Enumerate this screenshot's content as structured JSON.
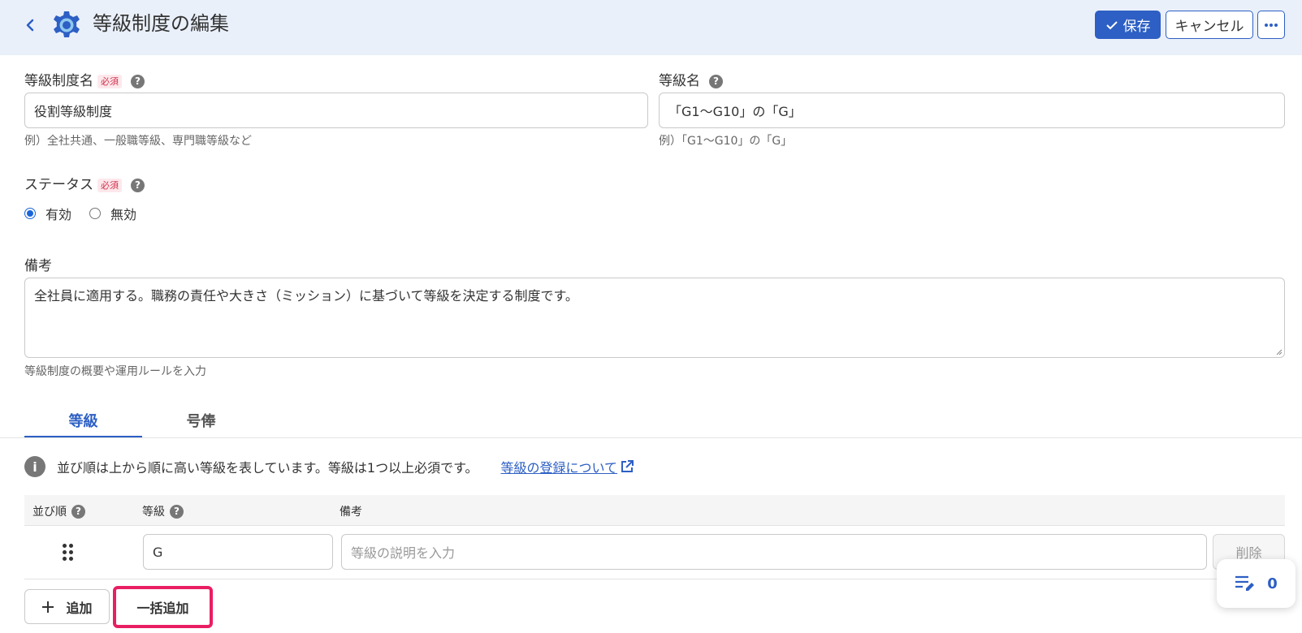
{
  "header": {
    "title": "等級制度の編集",
    "save_label": "保存",
    "cancel_label": "キャンセル"
  },
  "form": {
    "system_name": {
      "label": "等級制度名",
      "required": "必須",
      "value": "役割等級制度",
      "hint": "例）全社共通、一般職等級、専門職等級など"
    },
    "grade_name": {
      "label": "等級名",
      "value": "「G1〜G10」の「G」",
      "hint": "例）「G1〜G10」の「G」"
    },
    "status": {
      "label": "ステータス",
      "required": "必須",
      "options": [
        "有効",
        "無効"
      ],
      "selected": "有効"
    },
    "remarks": {
      "label": "備考",
      "value": "全社員に適用する。職務の責任や大きさ（ミッション）に基づいて等級を決定する制度です。",
      "hint": "等級制度の概要や運用ルールを入力"
    }
  },
  "tabs": [
    {
      "label": "等級",
      "active": true
    },
    {
      "label": "号俸",
      "active": false
    }
  ],
  "info": {
    "text": "並び順は上から順に高い等級を表しています。等級は1つ以上必須です。",
    "link": "等級の登録について"
  },
  "table": {
    "headers": [
      "並び順",
      "等級",
      "備考"
    ],
    "rows": [
      {
        "grade": "G",
        "remarks_placeholder": "等級の説明を入力",
        "delete_label": "削除"
      }
    ]
  },
  "actions": {
    "add_label": "追加",
    "bulk_add_label": "一括追加"
  },
  "float_counter": "0",
  "colors": {
    "accent": "#2d5fc4",
    "header_bg": "#eaf0fa",
    "highlight": "#e91e63",
    "required": "#d0304b"
  }
}
